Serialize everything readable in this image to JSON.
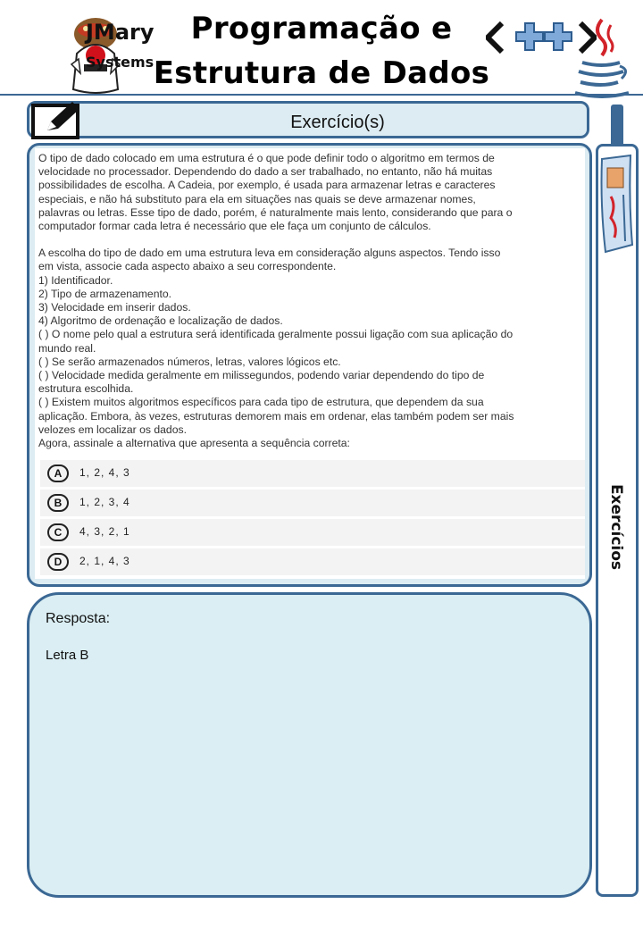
{
  "header": {
    "brand_name": "JMary",
    "brand_sub": "Systems",
    "title_line1": "Programação e",
    "title_line2": "Estrutura de Dados"
  },
  "exercise": {
    "header_label": "Exercício(s)",
    "paragraphs": [
      "O tipo de dado colocado em uma estrutura é o que pode definir todo o algoritmo em termos de\nvelocidade no processador. Dependendo do dado a ser trabalhado, no entanto, não há muitas\npossibilidades de escolha. A Cadeia, por exemplo, é usada para armazenar letras e caracteres\nespeciais, e não há substituto para ela em situações nas quais se deve armazenar nomes,\npalavras ou letras. Esse tipo de dado, porém, é naturalmente mais lento, considerando que para o\ncomputador formar cada letra é necessário que ele faça um conjunto de cálculos.",
      "A escolha do tipo de dado em uma estrutura leva em consideração alguns aspectos. Tendo isso\nem vista, associe cada aspecto abaixo a seu correspondente.\n1) Identificador.\n2) Tipo de armazenamento.\n3) Velocidade em inserir dados.\n4) Algoritmo de ordenação e localização de dados.\n( ) O nome pelo qual a estrutura será identificada geralmente possui ligação com sua aplicação do\nmundo real.\n( ) Se serão armazenados números, letras, valores lógicos etc.\n( ) Velocidade medida geralmente em milissegundos, podendo variar dependendo do tipo de\nestrutura escolhida.\n( ) Existem muitos algoritmos específicos para cada tipo de estrutura, que dependem da sua\naplicação. Embora, às vezes, estruturas demorem mais em ordenar, elas também podem ser mais\nvelozes em localizar os dados.\nAgora, assinale a alternativa que apresenta a sequência correta:"
    ],
    "alternatives": [
      {
        "letter": "A",
        "text": "1, 2, 4, 3"
      },
      {
        "letter": "B",
        "text": "1, 2, 3, 4"
      },
      {
        "letter": "C",
        "text": "4, 3, 2, 1"
      },
      {
        "letter": "D",
        "text": "2, 1, 4, 3"
      }
    ]
  },
  "answer": {
    "label": "Resposta:",
    "value": "Letra B"
  },
  "side": {
    "label": "Exercícios"
  },
  "icons": {
    "mascot": "duke-mascot-icon",
    "edit": "edit-pencil-icon",
    "code": "code-arrows-plus-icon",
    "java": "java-cup-icon",
    "side": "newspaper-icon"
  },
  "colors": {
    "accent": "#3b6894",
    "panel": "#dcecf2",
    "answer_bg": "#daeef3"
  }
}
